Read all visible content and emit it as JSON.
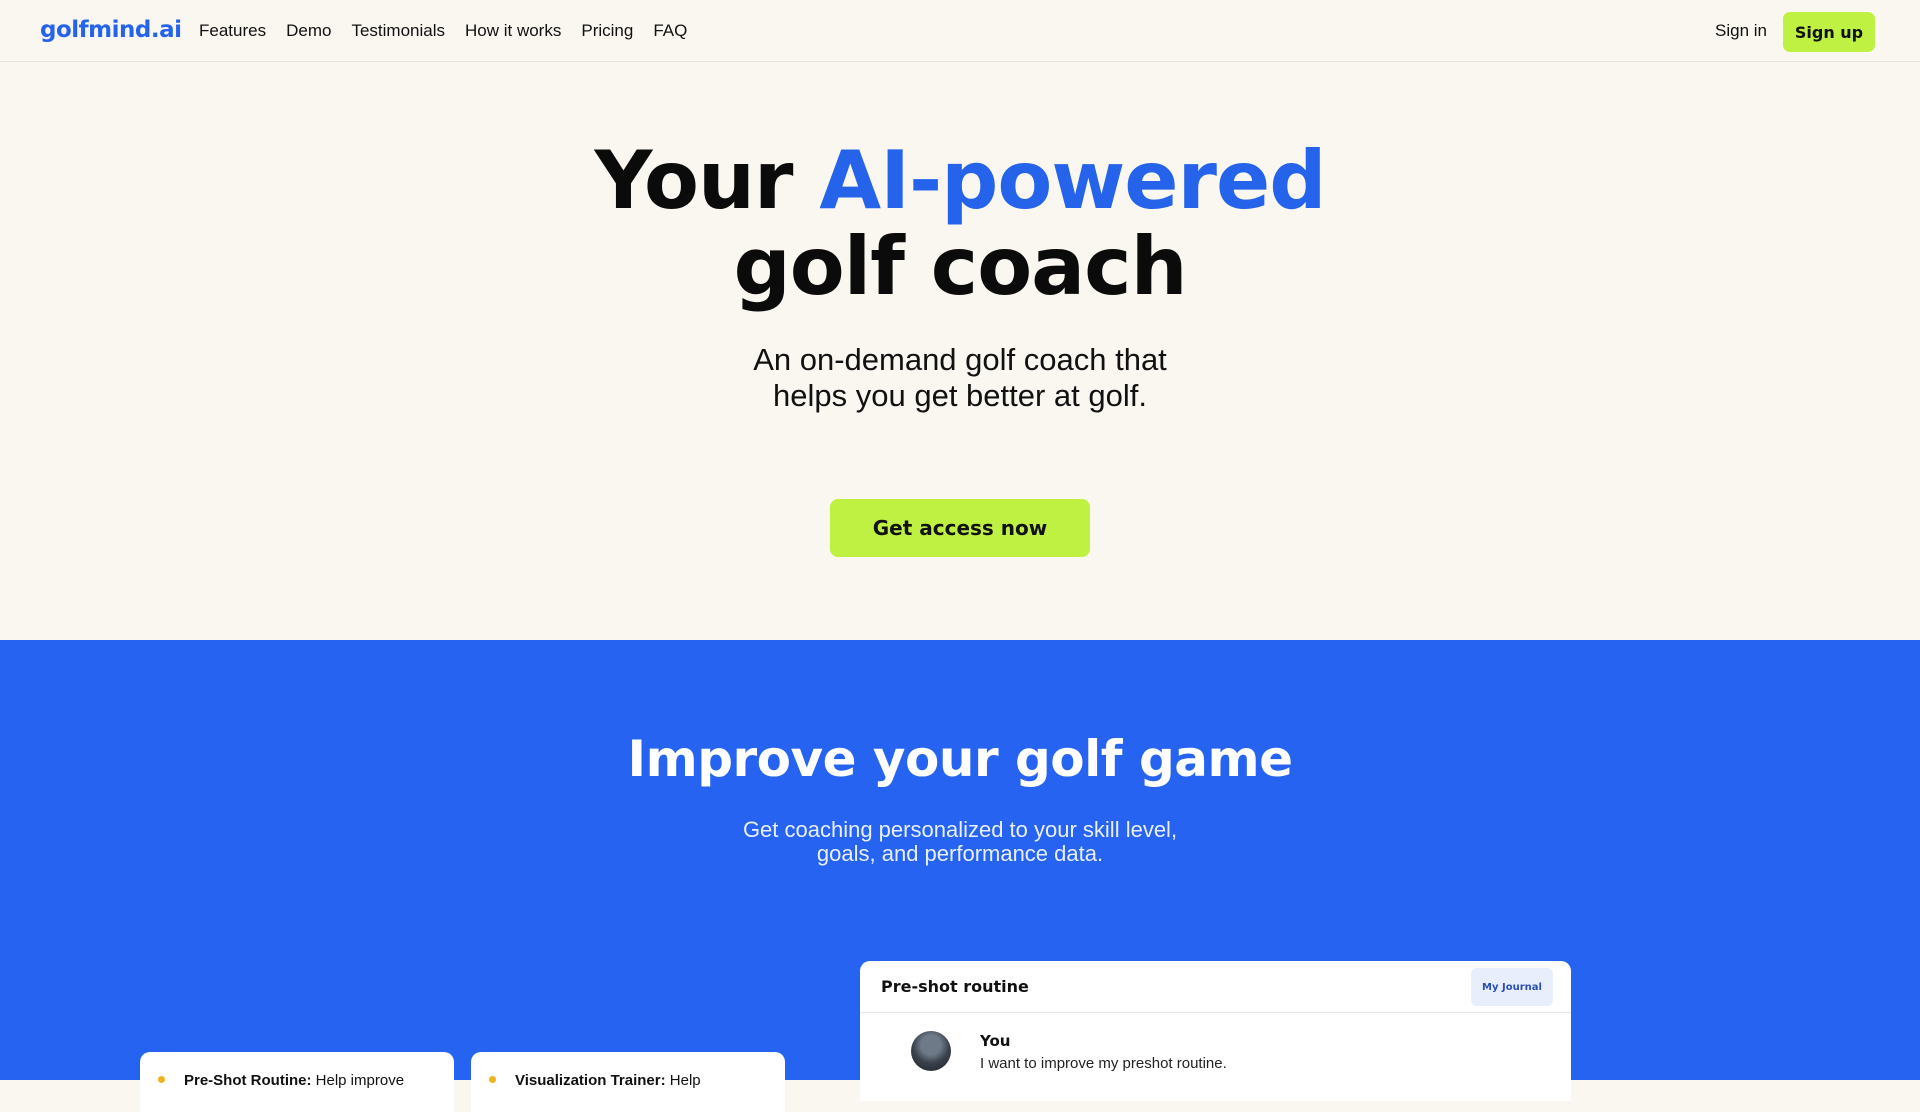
{
  "nav": {
    "logo": "golfmind.ai",
    "links": [
      "Features",
      "Demo",
      "Testimonials",
      "How it works",
      "Pricing",
      "FAQ"
    ],
    "sign_in": "Sign in",
    "sign_up": "Sign up"
  },
  "hero": {
    "title_part1": "Your ",
    "title_accent": "AI-powered",
    "title_part2": "golf coach",
    "subtitle_line1": "An on-demand golf coach that",
    "subtitle_line2": "helps you get better at golf.",
    "cta": "Get access now"
  },
  "improve": {
    "title": "Improve your golf game",
    "subtitle_line1": "Get coaching personalized to your skill level,",
    "subtitle_line2": "goals, and performance data.",
    "cards": [
      {
        "title": "Pre-Shot Routine:",
        "text": " Help improve"
      },
      {
        "title": "Visualization Trainer:",
        "text": " Help"
      }
    ],
    "chat": {
      "title": "Pre-shot routine",
      "journal_button": "My Journal",
      "author": "You",
      "message": "I want to improve my preshot routine."
    }
  },
  "colors": {
    "accent_blue": "#2563eb",
    "lime": "#bef141",
    "section_blue": "#2563f0",
    "cream": "#faf7f1"
  }
}
